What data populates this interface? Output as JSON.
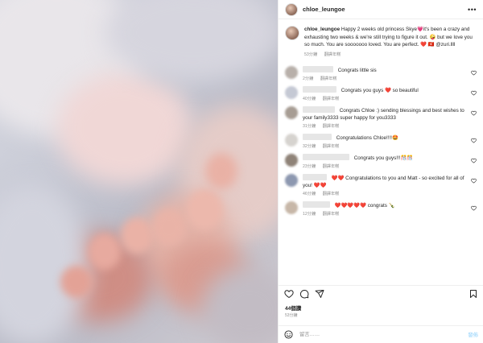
{
  "header": {
    "username": "chloe_leungoe",
    "more_icon": "more-horizontal-icon"
  },
  "caption": {
    "username": "chloe_leungoe",
    "text": "Happy 2 weeks old princess Skye💗it's been a crazy and exhausting two weeks & we're still trying to figure it out. 🤪 but we love you so much. You are sooooooo loved. You are perfect. ❤️ 🇭🇰 @zuri.llll",
    "time": "53分鐘",
    "translate": "翻譯年糕"
  },
  "comments": [
    {
      "text": "Congrats little sis",
      "time": "2分鐘",
      "translate": "翻譯年糕",
      "avatar_color": "#b8b0aa"
    },
    {
      "text": "Congrats you guys ❤️ so beautiful",
      "time": "40分鐘",
      "translate": "翻譯年糕",
      "avatar_color": "#c5c9d4"
    },
    {
      "text": "Congrats Chloe :) sending blessings and best wishes to your family3333 super happy for you3333",
      "time": "31分鐘",
      "translate": "翻譯年糕",
      "avatar_color": "#a79d94"
    },
    {
      "text": "Congratulations Chloe!!!!🤩",
      "time": "32分鐘",
      "translate": "翻譯年糕",
      "avatar_color": "#d6d3cf"
    },
    {
      "text": "Congrats you guys!!!🎊🎊",
      "time": "23分鐘",
      "translate": "翻譯年糕",
      "avatar_color": "#8f8378"
    },
    {
      "text": "❤️❤️ Congratulations to you and Matt - so excited for all of you! ❤️❤️",
      "time": "46分鐘",
      "translate": "翻譯年糕",
      "avatar_color": "#8d98b0"
    },
    {
      "text": "❤️❤️❤️❤️❤️ congrats 🍾",
      "time": "12分鐘",
      "translate": "翻譯年糕",
      "avatar_color": "#c7b7a8"
    }
  ],
  "actions": {
    "like_icon": "heart-icon",
    "comment_icon": "comment-icon",
    "share_icon": "send-icon",
    "save_icon": "bookmark-icon"
  },
  "likes": "44個讚",
  "date": "53分鐘",
  "add_comment": {
    "placeholder": "留言……",
    "post_label": "發佈",
    "emoji_icon": "smiley-icon"
  },
  "colors": {
    "heart": "#ed4956",
    "link_disabled": "#b2dffc",
    "muted": "#8e8e8e"
  }
}
